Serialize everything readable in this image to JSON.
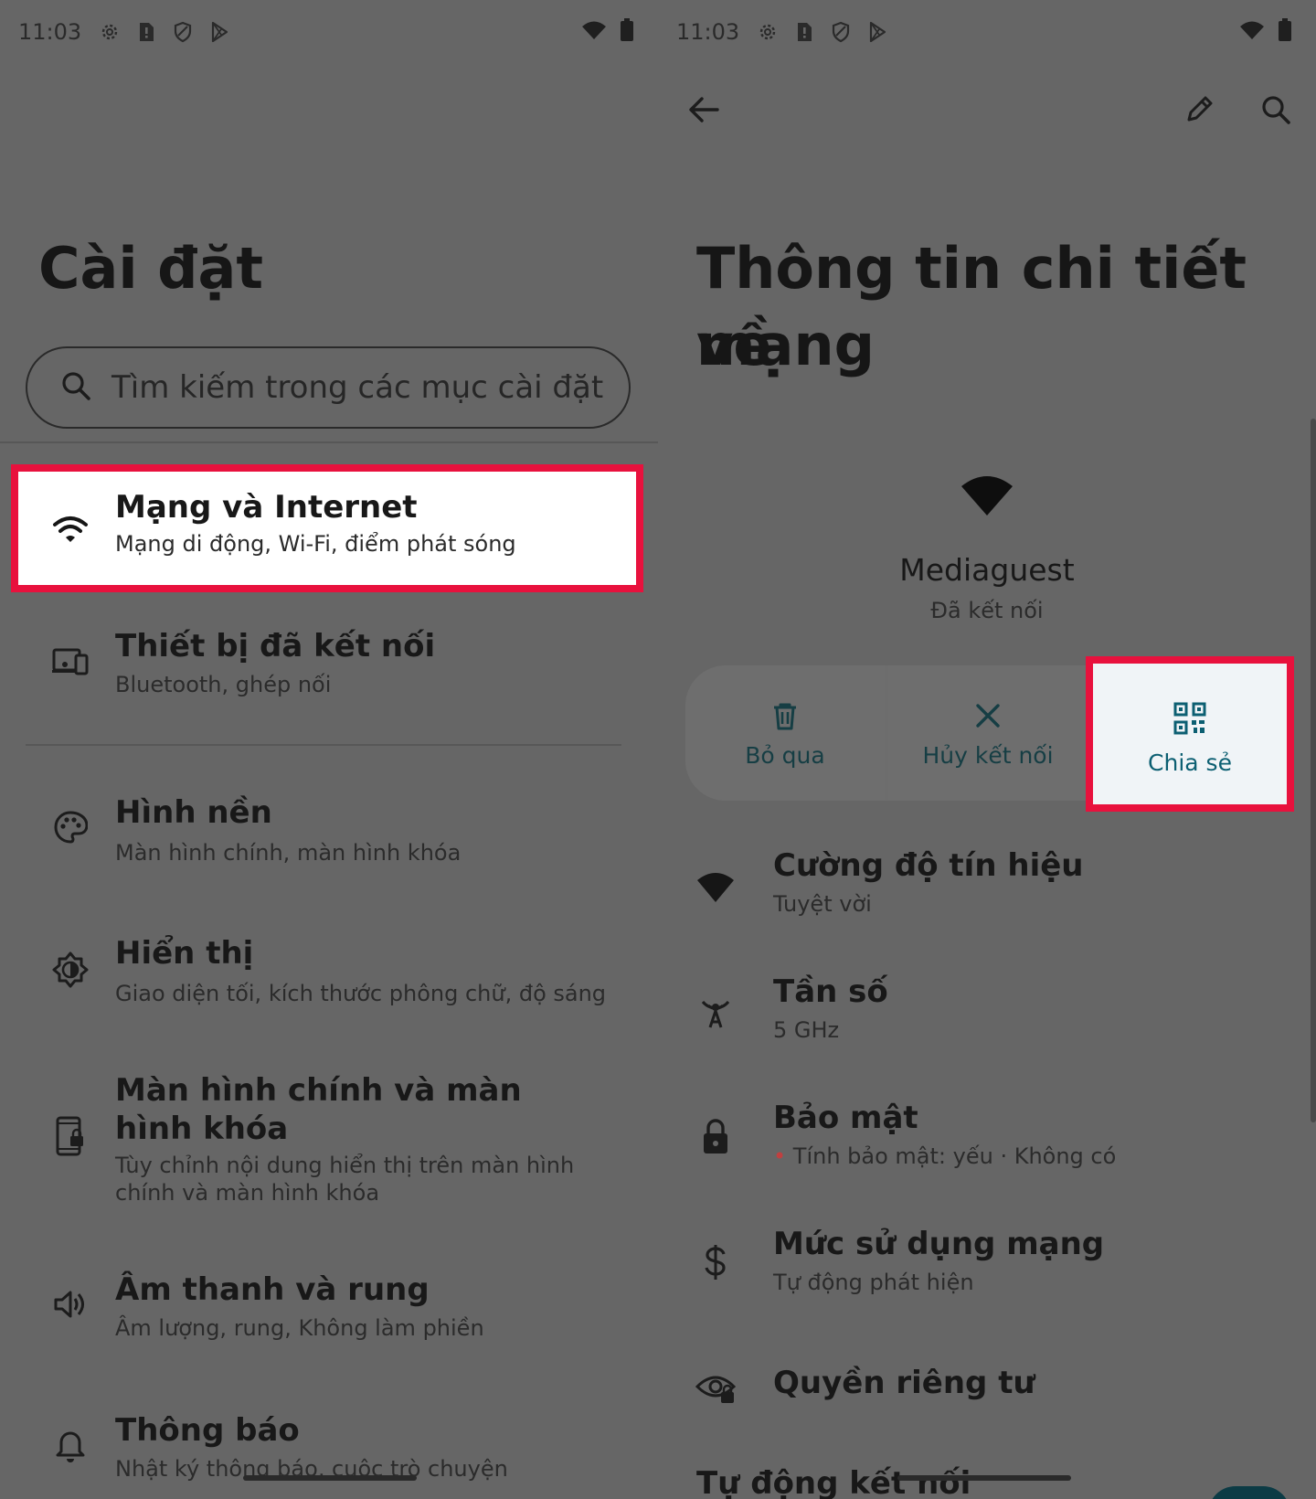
{
  "colors": {
    "background": "#666666",
    "highlight": "#e8113d",
    "accent": "#0c5f72",
    "action_text": "#163e44"
  },
  "left": {
    "status": {
      "time": "11:03",
      "icons": [
        "gear-icon",
        "alert-icon",
        "shield-icon",
        "play-store-icon"
      ],
      "right_icons": [
        "wifi-icon",
        "battery-icon"
      ]
    },
    "title": "Cài đặt",
    "search": {
      "placeholder": "Tìm kiếm trong các mục cài đặt",
      "icon": "search-icon"
    },
    "items": [
      {
        "title": "Mạng và Internet",
        "subtitle": "Mạng di động, Wi‑Fi, điểm phát sóng",
        "icon": "wifi-icon"
      },
      {
        "title": "Thiết bị đã kết nối",
        "subtitle": "Bluetooth, ghép nối",
        "icon": "devices-icon"
      },
      {
        "title": "Hình nền",
        "subtitle": "Màn hình chính, màn hình khóa",
        "icon": "palette-icon"
      },
      {
        "title": "Hiển thị",
        "subtitle": "Giao diện tối, kích thước phông chữ, độ sáng",
        "icon": "brightness-icon"
      },
      {
        "title": "Màn hình chính và màn hình khóa",
        "subtitle": "Tùy chỉnh nội dung hiển thị trên màn hình chính và màn hình khóa",
        "icon": "lockscreen-icon"
      },
      {
        "title": "Âm thanh và rung",
        "subtitle": "Âm lượng, rung, Không làm phiền",
        "icon": "volume-icon"
      },
      {
        "title": "Thông báo",
        "subtitle": "Nhật ký thông báo, cuộc trò chuyện",
        "icon": "bell-icon"
      }
    ]
  },
  "right": {
    "status": {
      "time": "11:03"
    },
    "toolbar": {
      "back": "back-arrow-icon",
      "edit": "pencil-icon",
      "search": "search-icon"
    },
    "title_line1": "Thông tin chi tiết về",
    "title_line2": "mạng",
    "network": {
      "name": "Mediaguest",
      "status": "Đã kết nối"
    },
    "actions": [
      {
        "label": "Bỏ qua",
        "icon": "delete-icon"
      },
      {
        "label": "Hủy kết nối",
        "icon": "close-icon"
      },
      {
        "label": "Chia sẻ",
        "icon": "qr-code-icon"
      }
    ],
    "details": [
      {
        "title": "Cường độ tín hiệu",
        "subtitle": "Tuyệt vời",
        "icon": "wifi-signal-icon"
      },
      {
        "title": "Tần số",
        "subtitle": "5 GHz",
        "icon": "antenna-icon"
      },
      {
        "title": "Bảo mật",
        "subtitle": "Tính bảo mật: yếu · Không có",
        "subtitle_bullet": "•",
        "icon": "lock-icon"
      },
      {
        "title": "Mức sử dụng mạng",
        "subtitle": "Tự động phát hiện",
        "icon": "dollar-icon"
      },
      {
        "title": "Quyền riêng tư",
        "subtitle": "",
        "icon": "privacy-eye-icon"
      },
      {
        "title": "Tự động kết nối",
        "subtitle": "",
        "icon": ""
      }
    ]
  }
}
